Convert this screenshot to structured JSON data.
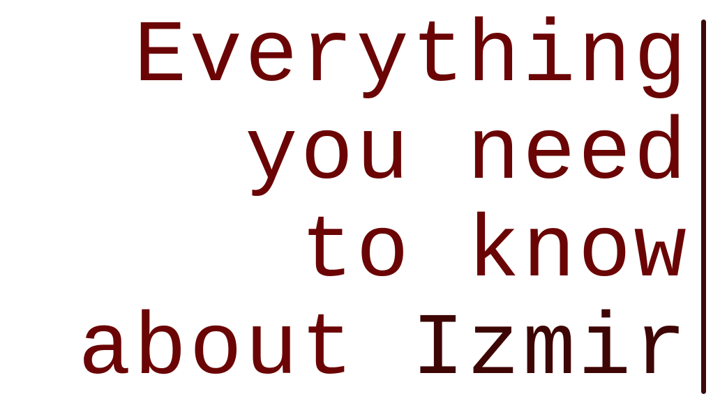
{
  "headline": {
    "line1": "Everything",
    "line2": "you need",
    "line3": "to know",
    "line4_prefix": "about",
    "line4_emphasis": "Izmir"
  },
  "colors": {
    "text": "#6b0505",
    "emphasis": "#3e0505",
    "rule": "#3a0b0b",
    "background": "#ffffff"
  }
}
